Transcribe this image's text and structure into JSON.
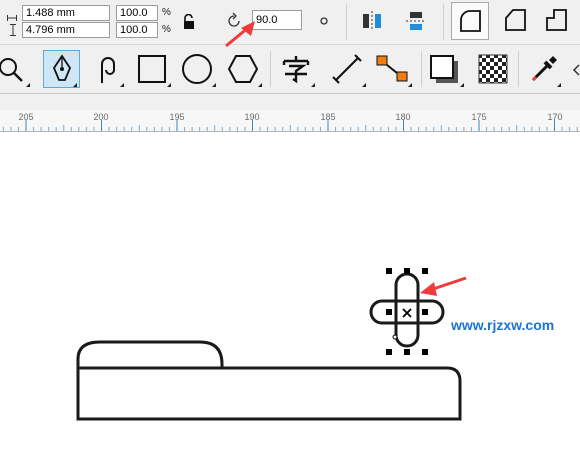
{
  "property_bar": {
    "width_value": "1.488 mm",
    "height_value": "4.796 mm",
    "scale_x": "100.0",
    "scale_y": "100.0",
    "percent_x": "%",
    "percent_y": "%",
    "rotation_value": "90.0"
  },
  "ruler": {
    "ticks": [
      "205",
      "200",
      "195",
      "190",
      "185",
      "180",
      "175",
      "170"
    ]
  },
  "watermark": "www.rjzxw.com",
  "colors": {
    "annotation_arrow": "#ef3b3b",
    "watermark_text": "#1c74d4",
    "ruler_text": "#6b6b6b",
    "active_tool_bg": "#cfe6f7"
  }
}
